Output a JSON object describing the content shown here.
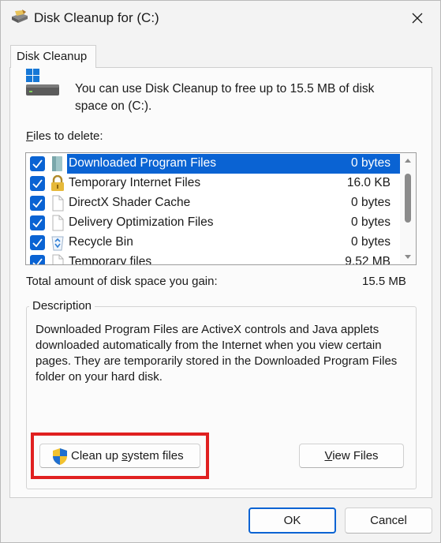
{
  "window": {
    "title": "Disk Cleanup for  (C:)",
    "close_glyph": "✕"
  },
  "tab": {
    "label": "Disk Cleanup"
  },
  "intro": {
    "text": "You can use Disk Cleanup to free up to 15.5 MB of disk space on  (C:)."
  },
  "files": {
    "label_prefix": "F",
    "label_rest": "iles to delete:",
    "items": [
      {
        "name": "Downloaded Program Files",
        "size": "0 bytes",
        "checked": true,
        "selected": true,
        "icon": "folder-icon"
      },
      {
        "name": "Temporary Internet Files",
        "size": "16.0 KB",
        "checked": true,
        "selected": false,
        "icon": "lock-icon"
      },
      {
        "name": "DirectX Shader Cache",
        "size": "0 bytes",
        "checked": true,
        "selected": false,
        "icon": "document-icon"
      },
      {
        "name": "Delivery Optimization Files",
        "size": "0 bytes",
        "checked": true,
        "selected": false,
        "icon": "document-icon"
      },
      {
        "name": "Recycle Bin",
        "size": "0 bytes",
        "checked": true,
        "selected": false,
        "icon": "recycle-bin-icon"
      },
      {
        "name": "Temporary files",
        "size": "9.52 MB",
        "checked": true,
        "selected": false,
        "icon": "document-icon"
      }
    ]
  },
  "total": {
    "label": "Total amount of disk space you gain:",
    "value": "15.5 MB"
  },
  "description": {
    "legend": "Description",
    "text": "Downloaded Program Files are ActiveX controls and Java applets downloaded automatically from the Internet when you view certain pages. They are temporarily stored in the Downloaded Program Files folder on your hard disk."
  },
  "buttons": {
    "cleanup_prefix": "Clean up ",
    "cleanup_underlined": "s",
    "cleanup_rest": "ystem files",
    "viewfiles_underlined": "V",
    "viewfiles_rest": "iew Files",
    "ok": "OK",
    "cancel": "Cancel"
  },
  "colors": {
    "accent": "#0a63d3",
    "highlight_border": "#e02020"
  }
}
